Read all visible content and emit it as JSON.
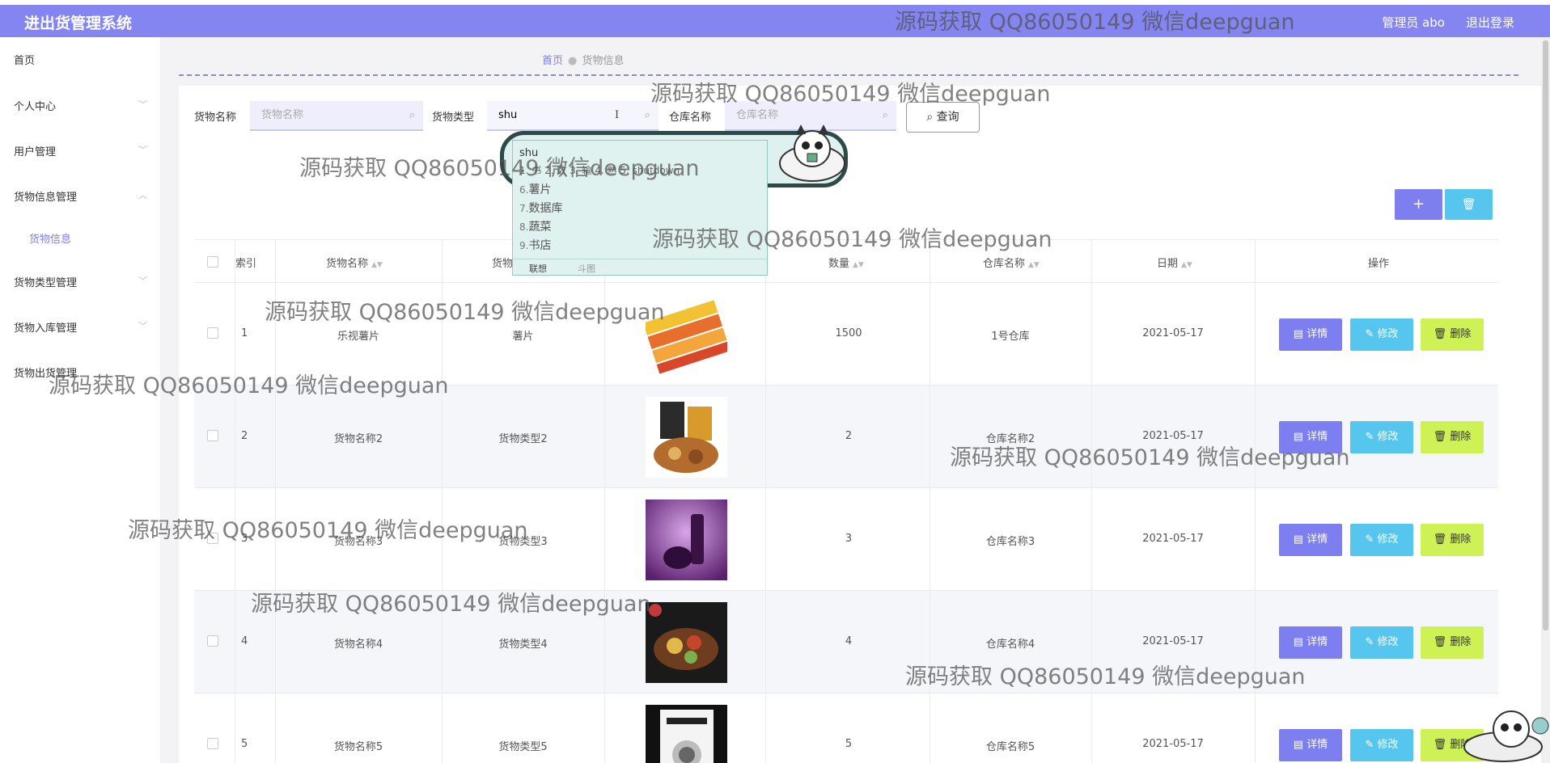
{
  "header": {
    "brand": "进出货管理系统",
    "admin_label": "管理员 abo",
    "logout_label": "退出登录"
  },
  "sidebar": {
    "items": [
      {
        "label": "首页",
        "chevron": ""
      },
      {
        "label": "个人中心",
        "chevron": "﹀"
      },
      {
        "label": "用户管理",
        "chevron": "﹀"
      },
      {
        "label": "货物信息管理",
        "chevron": "︿"
      },
      {
        "label": "货物类型管理",
        "chevron": "﹀"
      },
      {
        "label": "货物入库管理",
        "chevron": "﹀"
      },
      {
        "label": "货物出货管理",
        "chevron": ""
      }
    ],
    "sub_item": "货物信息"
  },
  "breadcrumb": {
    "home": "首页",
    "current": "货物信息"
  },
  "search": {
    "name_label": "货物名称",
    "name_placeholder": "货物名称",
    "type_label": "货物类型",
    "type_value": "shu",
    "warehouse_label": "仓库名称",
    "warehouse_placeholder": "仓库名称",
    "query_label": "查询"
  },
  "toolbar": {
    "add_label": "+",
    "delete_label": "🗑"
  },
  "table": {
    "headers": [
      "索引",
      "货物名称",
      "货物",
      "数量",
      "仓库名称",
      "日期",
      "操作"
    ],
    "rows": [
      {
        "index": "1",
        "name": "乐视薯片",
        "type": "薯片",
        "qty": "1500",
        "warehouse": "1号仓库",
        "date": "2021-05-17",
        "img": "chips"
      },
      {
        "index": "2",
        "name": "货物名称2",
        "type": "货物类型2",
        "qty": "2",
        "warehouse": "仓库名称2",
        "date": "2021-05-17",
        "img": "snacks"
      },
      {
        "index": "3",
        "name": "货物名称3",
        "type": "货物类型3",
        "qty": "3",
        "warehouse": "仓库名称3",
        "date": "2021-05-17",
        "img": "cosmetics"
      },
      {
        "index": "4",
        "name": "货物名称4",
        "type": "货物类型4",
        "qty": "4",
        "warehouse": "仓库名称4",
        "date": "2021-05-17",
        "img": "food"
      },
      {
        "index": "5",
        "name": "货物名称5",
        "type": "货物类型5",
        "qty": "5",
        "warehouse": "仓库名称5",
        "date": "2021-05-17",
        "img": "book"
      }
    ],
    "actions": {
      "detail": "详情",
      "edit": "修改",
      "remove": "删除"
    }
  },
  "ime": {
    "typed": "shu",
    "candidates_line": "1. 书  2. 数  3. 输  4. 熟  5. shutdown",
    "list": [
      {
        "n": "6.",
        "text": "薯片"
      },
      {
        "n": "7.",
        "text": "数据库"
      },
      {
        "n": "8.",
        "text": "蔬菜"
      },
      {
        "n": "9.",
        "text": "书店"
      }
    ],
    "tab_1": "联想",
    "tab_2": "斗图"
  },
  "watermark": "源码获取 QQ86050149 微信deepguan"
}
